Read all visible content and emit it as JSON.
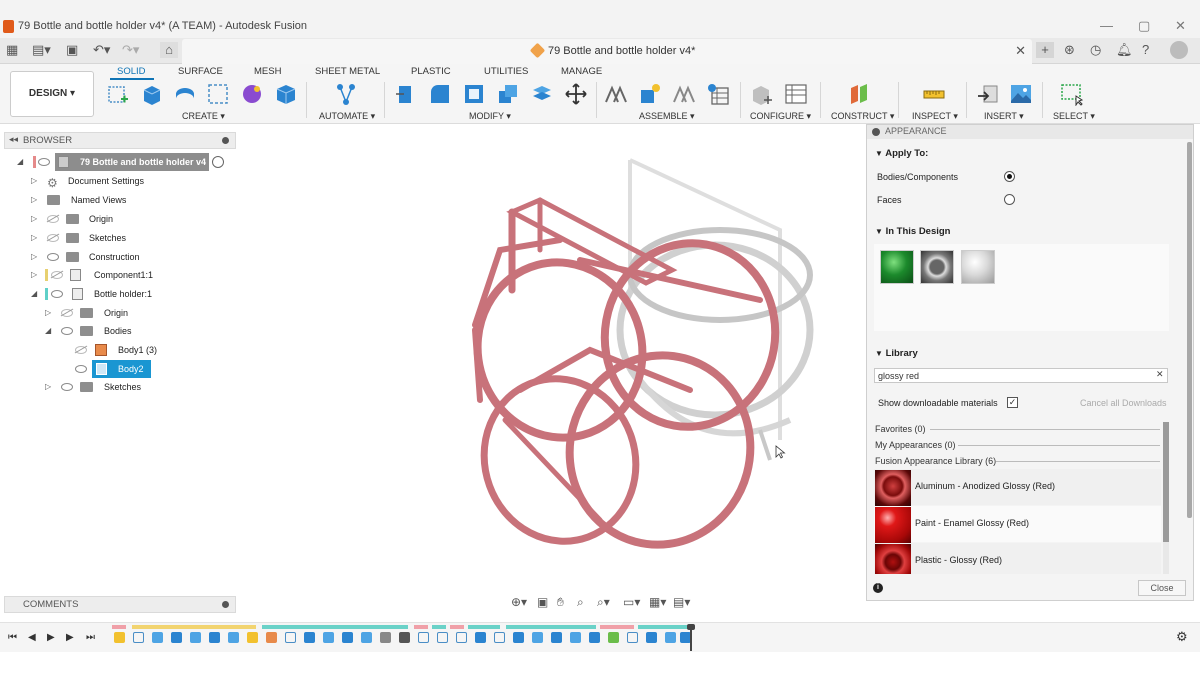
{
  "window": {
    "title": "79 Bottle and bottle holder v4* (A TEAM) - Autodesk Fusion",
    "controls": [
      "—",
      "▢",
      "✕"
    ]
  },
  "tab": {
    "title": "79 Bottle and bottle holder v4*",
    "close": "✕"
  },
  "ribbon": {
    "workspace": "DESIGN ▾",
    "tabs": [
      "SOLID",
      "SURFACE",
      "MESH",
      "SHEET METAL",
      "PLASTIC",
      "UTILITIES",
      "MANAGE"
    ],
    "groups": {
      "create": "CREATE ▾",
      "automate": "AUTOMATE ▾",
      "modify": "MODIFY ▾",
      "assemble": "ASSEMBLE ▾",
      "configure": "CONFIGURE ▾",
      "construct": "CONSTRUCT ▾",
      "inspect": "INSPECT ▾",
      "insert": "INSERT ▾",
      "select": "SELECT ▾"
    }
  },
  "browser": {
    "title": "BROWSER",
    "items": [
      {
        "label": "79 Bottle and bottle holder v4"
      },
      {
        "label": "Document Settings"
      },
      {
        "label": "Named Views"
      },
      {
        "label": "Origin"
      },
      {
        "label": "Sketches"
      },
      {
        "label": "Construction"
      },
      {
        "label": "Component1:1"
      },
      {
        "label": "Bottle holder:1"
      },
      {
        "label": "Origin"
      },
      {
        "label": "Bodies"
      },
      {
        "label": "Body1 (3)"
      },
      {
        "label": "Body2"
      },
      {
        "label": "Sketches"
      }
    ]
  },
  "comments": {
    "title": "COMMENTS"
  },
  "appearance": {
    "title": "APPEARANCE",
    "apply_to": {
      "title": "Apply To:",
      "options": [
        "Bodies/Components",
        "Faces"
      ],
      "selected": "Bodies/Components"
    },
    "in_this_design": {
      "title": "In This Design"
    },
    "library": {
      "title": "Library",
      "search_value": "glossy red",
      "clear": "✕",
      "show_downloadable": "Show downloadable materials",
      "show_downloadable_checked": true,
      "cancel_downloads": "Cancel all Downloads",
      "favorites": "Favorites (0)",
      "my_appearances": "My Appearances (0)",
      "fusion_library": "Fusion Appearance Library (6)",
      "materials": [
        "Aluminum - Anodized Glossy (Red)",
        "Paint - Enamel Glossy (Red)",
        "Plastic - Glossy (Red)"
      ]
    },
    "close": "Close",
    "info": "i"
  },
  "colors": {
    "accent": "#0f74b5",
    "model": "#c9727a",
    "selection": "#1a96d2"
  }
}
